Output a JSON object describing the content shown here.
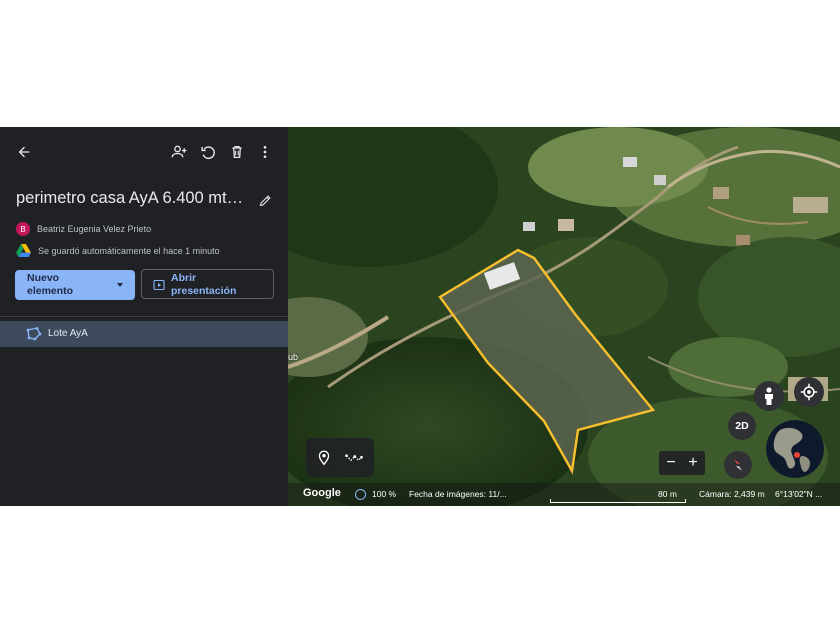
{
  "toolbar": {
    "back_icon": "arrow-left-icon",
    "share_icon": "add-person-icon",
    "history_icon": "history-icon",
    "delete_icon": "trash-icon",
    "more_icon": "more-vert-icon"
  },
  "project": {
    "title": "perimetro casa AyA 6.400 mts ...",
    "edit_icon": "pencil-icon",
    "owner_initial": "B",
    "owner_name": "Beatriz Eugenia Velez Prieto",
    "save_status": "Se guardó automáticamente el hace 1 minuto",
    "drive_icon": "google-drive-icon"
  },
  "actions": {
    "new_label_line1": "Nuevo",
    "new_label_line2": "elemento",
    "present_label_line1": "Abrir",
    "present_label_line2": "presentación"
  },
  "layers": [
    {
      "label": "Lote AyA",
      "icon": "polygon-icon",
      "color": "#f9c02d"
    }
  ],
  "map": {
    "edge_label": "ub",
    "brand": "Google",
    "opacity": "100 %",
    "imagery_date": "Fecha de imágenes: 11/...",
    "scale_label": "80 m",
    "camera": "Cámara: 2,439 m",
    "coordinates": "6°13'02\"N ...",
    "mode_label": "2D",
    "zoom_out": "−",
    "zoom_in": "+",
    "accent_color": "#8ab4f8",
    "polygon_color": "#f9c02d"
  }
}
